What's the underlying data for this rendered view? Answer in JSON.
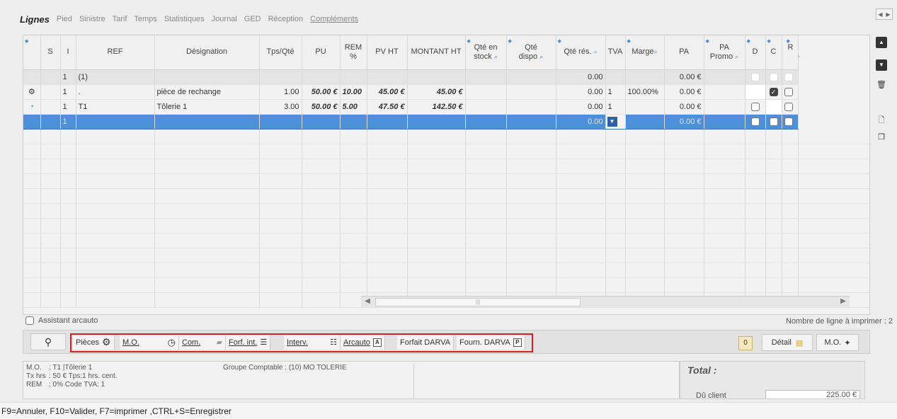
{
  "tabs": [
    {
      "label": "Lignes",
      "active": true
    },
    {
      "label": "Pied"
    },
    {
      "label": "Sinistre"
    },
    {
      "label": "Tarif"
    },
    {
      "label": "Temps"
    },
    {
      "label": "Statistiques"
    },
    {
      "label": "Journal"
    },
    {
      "label": "GED"
    },
    {
      "label": "Réception"
    },
    {
      "label": "Compléments"
    }
  ],
  "grid": {
    "headers": {
      "s": "S",
      "i": "I",
      "ref": "REF",
      "designation": "Désignation",
      "tps": "Tps/Qté",
      "pu": "PU",
      "rem": "REM %",
      "pvht": "PV HT",
      "montant": "MONTANT HT",
      "stock_1": "Qté en",
      "stock_2": "stock",
      "dispo_1": "Qté",
      "dispo_2": "dispo",
      "res": "Qté rés.",
      "tva": "TVA",
      "marge": "Marge",
      "pa": "PA",
      "promo_1": "PA",
      "promo_2": "Promo",
      "d": "D",
      "c": "C",
      "r": "R"
    },
    "rows": [
      {
        "i": "1",
        "ref": "(1)",
        "res": "0.00",
        "pa": "0.00 €"
      },
      {
        "i": "1",
        "ref": ".",
        "designation": "pièce de rechange",
        "tps": "1.00",
        "pu": "50.00 €",
        "rem": "10.00",
        "pvht": "45.00 €",
        "montant": "45.00 €",
        "res": "0.00",
        "tva": "1",
        "marge": "100.00%",
        "pa": "0.00 €"
      },
      {
        "i": "1",
        "ref": "T1",
        "designation": "Tôlerie 1",
        "tps": "3.00",
        "pu": "50.00 €",
        "rem": "5.00",
        "pvht": "47.50 €",
        "montant": "142.50 €",
        "res": "0.00",
        "tva": "1",
        "pa": "0.00 €"
      },
      {
        "i": "1",
        "res": "0.00",
        "pa": "0.00 €"
      }
    ]
  },
  "assistant": "Assistant arcauto",
  "line_count": "Nombre de ligne à imprimer : 2",
  "toolbar": {
    "pieces": "Pièces",
    "mo": "M.O.",
    "com": "Com.",
    "forf": "Forf. int.",
    "interv": "Interv.",
    "arcauto": "Arcauto",
    "arcauto_key": "A",
    "forfait_darva": "Forfait DARVA",
    "fourn_darva": "Fourn. DARVA",
    "fourn_key": "P",
    "zero": "0",
    "detail": "Détail",
    "mo_btn": "M.O."
  },
  "info": {
    "mo_label": "M.O.",
    "mo_value": ": T1 |Tôlerie 1",
    "tx_label": "Tx hrs",
    "tx_value": ": 50 € Tps:1 hrs. cent.",
    "rem_label": "REM",
    "rem_value": ": 0% Code TVA: 1",
    "groupe": "Groupe Comptable : (10) MO TOLERIE"
  },
  "total": {
    "title": "Total :",
    "due_label": "Dû client",
    "due_value": "225.00 €"
  },
  "status": "F9=Annuler, F10=Valider, F7=imprimer ,CTRL+S=Enregistrer"
}
